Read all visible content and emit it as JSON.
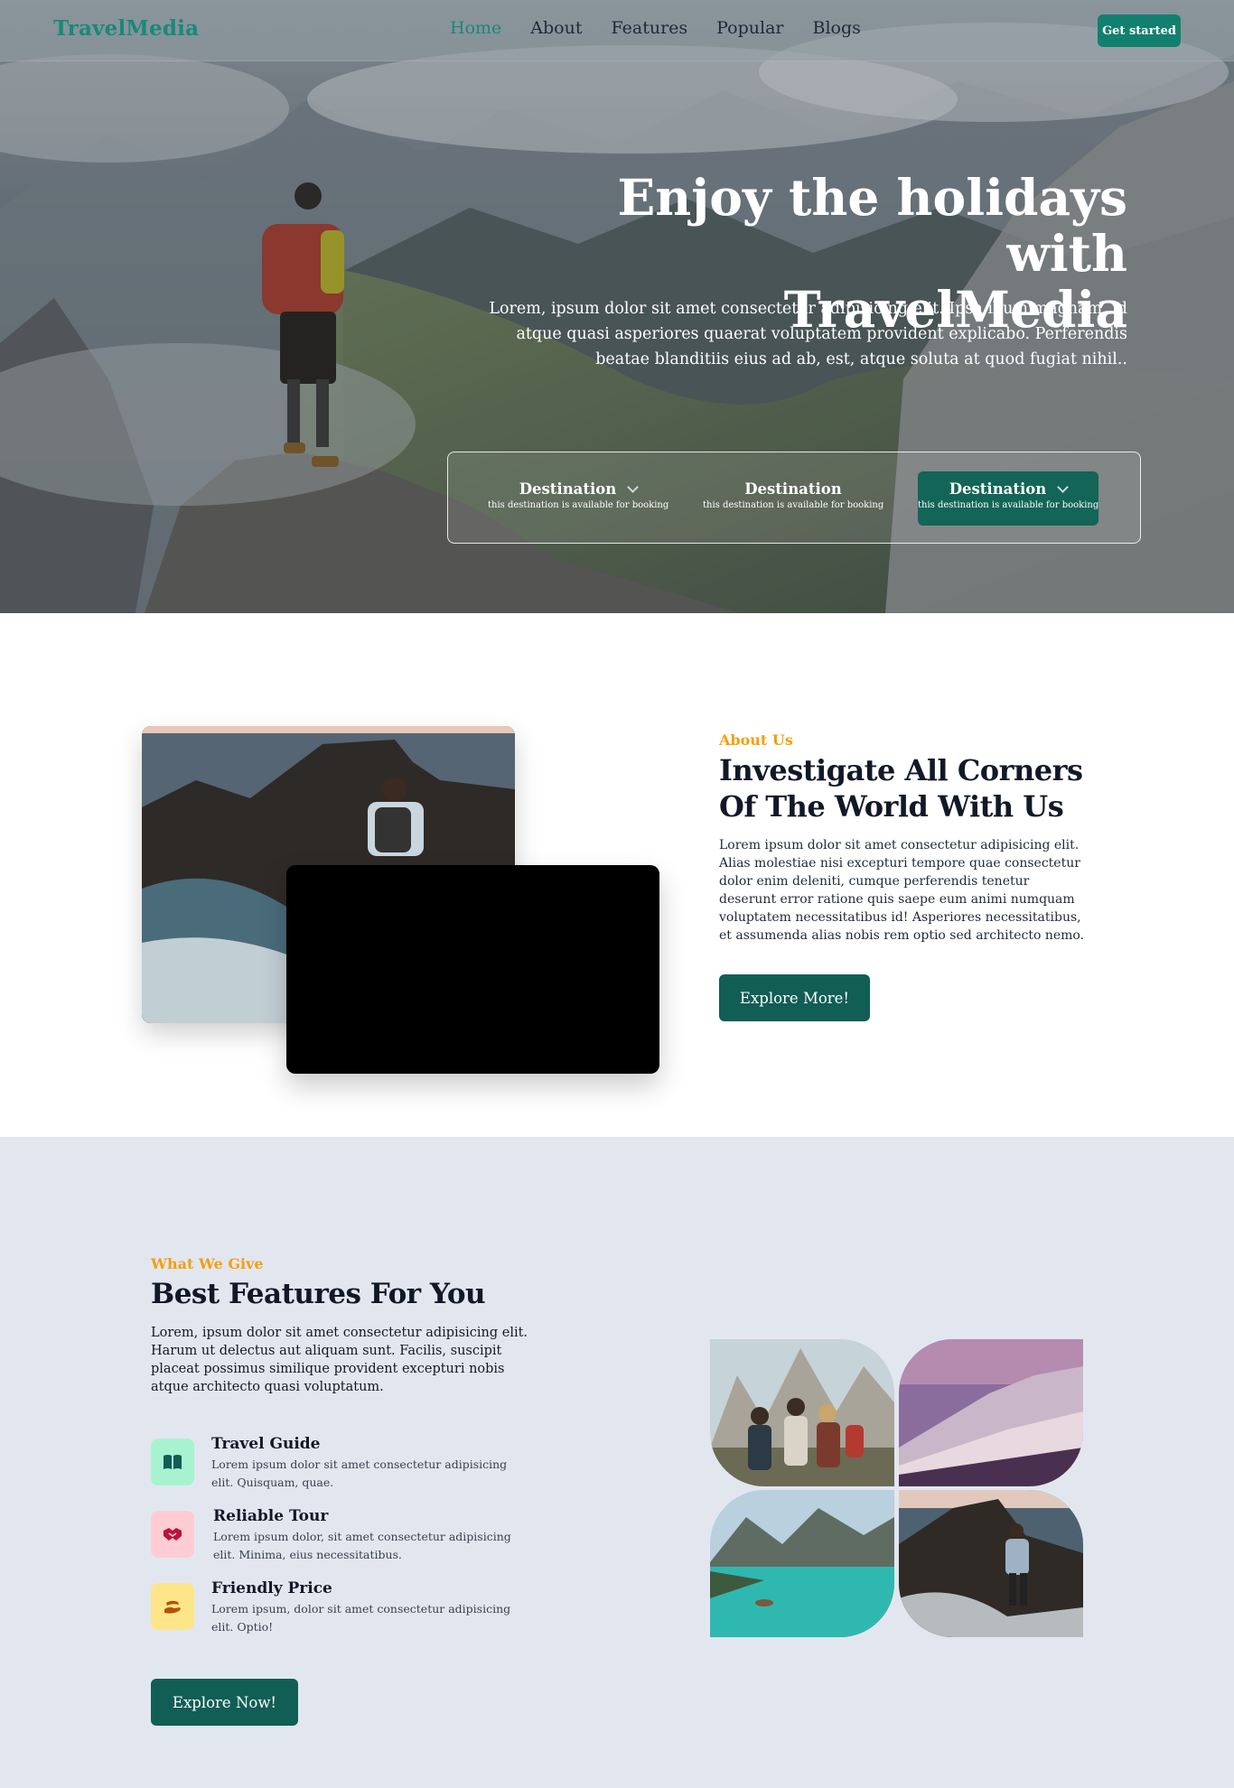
{
  "nav": {
    "logo": "TravelMedia",
    "links": [
      "Home",
      "About",
      "Features",
      "Popular",
      "Blogs"
    ],
    "active_link": "Home",
    "cta": "Get started"
  },
  "hero": {
    "title_line1": "Enjoy the holidays with",
    "title_line2": "TravelMedia",
    "subtitle": "Lorem, ipsum dolor sit amet consectetur adipisicing elit. Ipsa illum magnam, id atque quasi asperiores quaerat voluptatem provident explicabo. Perferendis beatae blanditiis eius ad ab, est, atque soluta at quod fugiat nihil..",
    "booking": [
      {
        "title": "Destination",
        "desc": "this destination is available for booking",
        "icon": "chevron-down-icon"
      },
      {
        "title": "Destination",
        "desc": "this destination is available for booking"
      },
      {
        "title": "Destination",
        "desc": "this destination is available for booking",
        "icon": "chevron-down-icon"
      }
    ]
  },
  "about": {
    "kicker": "About Us",
    "title": "Investigate All Corners Of The World With Us",
    "text": "Lorem ipsum dolor sit amet consectetur adipisicing elit. Alias molestiae nisi excepturi tempore quae consectetur dolor enim deleniti, cumque perferendis tenetur deserunt error ratione quis saepe eum animi numquam voluptatem necessitatibus id! Asperiores necessitatibus, et assumenda alias nobis rem optio sed architecto nemo.",
    "button": "Explore More!"
  },
  "features": {
    "kicker": "What We Give",
    "title": "Best Features For You",
    "text": "Lorem, ipsum dolor sit amet consectetur adipisicing elit. Harum ut delectus aut aliquam sunt. Facilis, suscipit placeat possimus similique provident excepturi nobis atque architecto quasi voluptatum.",
    "items": [
      {
        "name": "Travel Guide",
        "desc": "Lorem ipsum dolor sit amet consectetur adipisicing elit. Quisquam, quae.",
        "icon": "book-icon",
        "color": "#a7f3d0"
      },
      {
        "name": "Reliable Tour",
        "desc": "Lorem ipsum dolor, sit amet consectetur adipisicing elit. Minima, eius necessitatibus.",
        "icon": "handshake-icon",
        "color": "#fecdd3"
      },
      {
        "name": "Friendly Price",
        "desc": "Lorem ipsum, dolor sit amet consectetur adipisicing elit. Optio!",
        "icon": "hand-coin-icon",
        "color": "#fde68a"
      }
    ],
    "button": "Explore Now!"
  },
  "colors": {
    "brand": "#178a79",
    "button_dark": "#115e55",
    "accent": "#f59e0b",
    "section_bg": "#e2e7ef"
  }
}
